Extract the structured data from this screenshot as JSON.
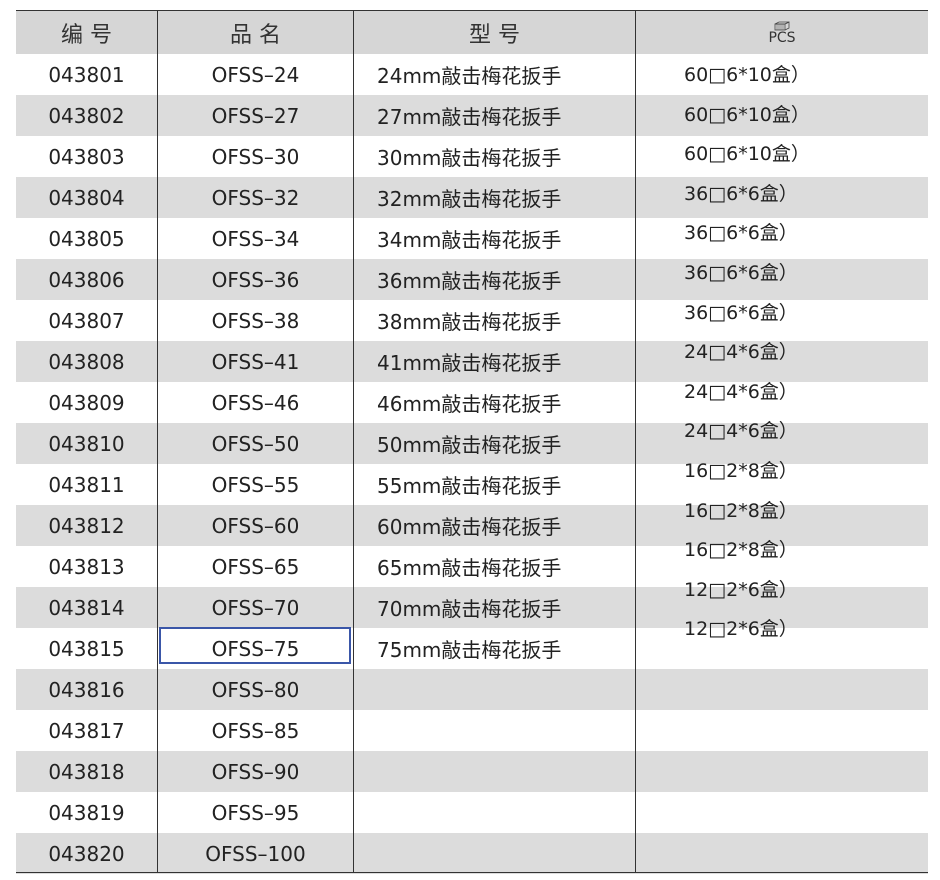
{
  "headers": {
    "code": "编 号",
    "name": "品 名",
    "model": "型 号",
    "pcs_icon": "box-icon",
    "pcs": "PCS"
  },
  "rows": [
    {
      "code": "043801",
      "name": "OFSS–24",
      "model": "24mm敲击梅花扳手"
    },
    {
      "code": "043802",
      "name": "OFSS–27",
      "model": "27mm敲击梅花扳手"
    },
    {
      "code": "043803",
      "name": "OFSS–30",
      "model": "30mm敲击梅花扳手"
    },
    {
      "code": "043804",
      "name": "OFSS–32",
      "model": "32mm敲击梅花扳手"
    },
    {
      "code": "043805",
      "name": "OFSS–34",
      "model": "34mm敲击梅花扳手"
    },
    {
      "code": "043806",
      "name": "OFSS–36",
      "model": "36mm敲击梅花扳手"
    },
    {
      "code": "043807",
      "name": "OFSS–38",
      "model": "38mm敲击梅花扳手"
    },
    {
      "code": "043808",
      "name": "OFSS–41",
      "model": "41mm敲击梅花扳手"
    },
    {
      "code": "043809",
      "name": "OFSS–46",
      "model": "46mm敲击梅花扳手"
    },
    {
      "code": "043810",
      "name": "OFSS–50",
      "model": "50mm敲击梅花扳手"
    },
    {
      "code": "043811",
      "name": "OFSS–55",
      "model": "55mm敲击梅花扳手"
    },
    {
      "code": "043812",
      "name": "OFSS–60",
      "model": "60mm敲击梅花扳手"
    },
    {
      "code": "043813",
      "name": "OFSS–65",
      "model": "65mm敲击梅花扳手"
    },
    {
      "code": "043814",
      "name": "OFSS–70",
      "model": "70mm敲击梅花扳手"
    },
    {
      "code": "043815",
      "name": "OFSS–75",
      "model": "75mm敲击梅花扳手"
    },
    {
      "code": "043816",
      "name": "OFSS–80",
      "model": ""
    },
    {
      "code": "043817",
      "name": "OFSS–85",
      "model": ""
    },
    {
      "code": "043818",
      "name": "OFSS–90",
      "model": ""
    },
    {
      "code": "043819",
      "name": "OFSS–95",
      "model": ""
    },
    {
      "code": "043820",
      "name": "OFSS–100",
      "model": ""
    }
  ],
  "packing": [
    "60□6*10盒）",
    "60□6*10盒）",
    "60□6*10盒）",
    "36□6*6盒）",
    "36□6*6盒）",
    "36□6*6盒）",
    "36□6*6盒）",
    "24□4*6盒）",
    "24□4*6盒）",
    "24□4*6盒）",
    "16□2*8盒）",
    "16□2*8盒）",
    "16□2*8盒）",
    "12□2*6盒）",
    "12□2*6盒）"
  ],
  "selected_row": "043815",
  "colors": {
    "header_bg": "#d6d6d6",
    "stripe": "#dcdcdc",
    "selection": "#3a56a8",
    "rule": "#333333"
  }
}
